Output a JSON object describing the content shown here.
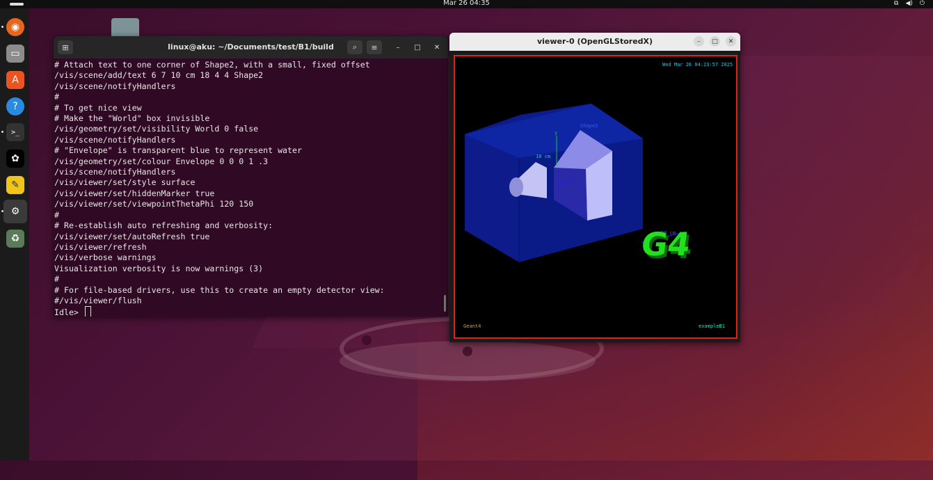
{
  "topbar": {
    "clock": "Mar 26  04:35",
    "tray_icons": [
      "network-icon",
      "volume-icon",
      "power-icon"
    ]
  },
  "dock": {
    "items": [
      {
        "name": "firefox-icon",
        "glyph": "🦊"
      },
      {
        "name": "files-icon",
        "glyph": "▭"
      },
      {
        "name": "app-center-icon",
        "glyph": "A"
      },
      {
        "name": "help-icon",
        "glyph": "?"
      },
      {
        "name": "terminal-icon",
        "glyph": ">_"
      },
      {
        "name": "chatgpt-icon",
        "glyph": "✿"
      },
      {
        "name": "text-editor-icon",
        "glyph": "✎"
      },
      {
        "name": "settings-icon",
        "glyph": "⚙"
      },
      {
        "name": "trash-icon",
        "glyph": "♻"
      }
    ]
  },
  "terminal": {
    "title": "linux@aku: ~/Documents/test/B1/build",
    "lines": [
      "# Attach text to one corner of Shape2, with a small, fixed offset",
      "/vis/scene/add/text 6 7 10 cm 18 4 4 Shape2",
      "/vis/scene/notifyHandlers",
      "#",
      "# To get nice view",
      "# Make the \"World\" box invisible",
      "/vis/geometry/set/visibility World 0 false",
      "/vis/scene/notifyHandlers",
      "# \"Envelope\" is transparent blue to represent water",
      "/vis/geometry/set/colour Envelope 0 0 0 1 .3",
      "/vis/scene/notifyHandlers",
      "/vis/viewer/set/style surface",
      "/vis/viewer/set/hiddenMarker true",
      "/vis/viewer/set/viewpointThetaPhi 120 150",
      "#",
      "# Re-establish auto refreshing and verbosity:",
      "/vis/viewer/set/autoRefresh true",
      "/vis/viewer/refresh",
      "/vis/verbose warnings",
      "Visualization verbosity is now warnings (3)",
      "#",
      "# For file-based drivers, use this to create an empty detector view:",
      "#/vis/viewer/flush"
    ],
    "prompt": "Idle>"
  },
  "viewer": {
    "title": "viewer-0 (OpenGLStoredX)",
    "date_label": "Wed Mar 26 04:23:57 2025",
    "axis_y_label": "y",
    "scale_label": "10 cm",
    "shape_label": "Shape2",
    "scale_label2": "10 cm",
    "logo_text": "G4",
    "footer_left": "Geant4",
    "footer_right": "exampleB1"
  },
  "colors": {
    "terminal_bg": "#300a24",
    "envelope_blue": "#0d1c8a",
    "frame_red": "#d9261c",
    "logo_green": "#22e01e",
    "label_cyan": "#25c7d8"
  }
}
